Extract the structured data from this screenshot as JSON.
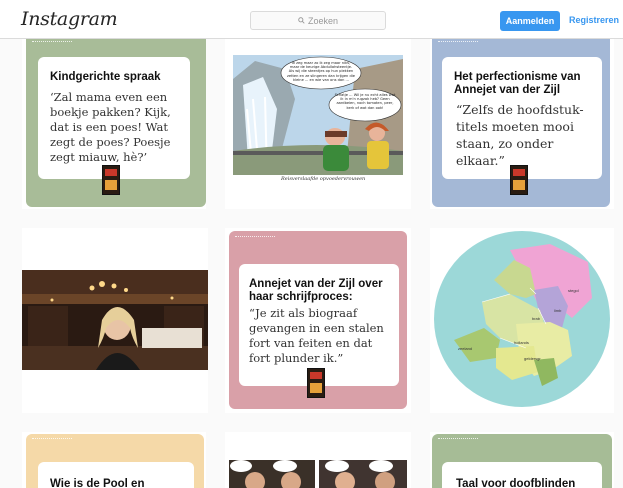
{
  "header": {
    "logo": "Instagram",
    "search_placeholder": "Zoeken",
    "login_label": "Aanmelden",
    "register_label": "Registreren"
  },
  "colors": {
    "accent": "#3897f0",
    "green_frame": "#a8bc98",
    "blue_frame": "#a4b8d6",
    "pink_frame": "#d9a0a8",
    "orange_frame": "#f5d9a8",
    "sage_frame": "#a6bc96"
  },
  "posts": {
    "p1": {
      "title": "Kindgerichte spraak",
      "quote": "‘Zal mama even een boekje pakken? Kijk, dat is een poes! Wat zegt de poes? Poesje zegt miauw, hè?’"
    },
    "p2": {
      "caption": "Reisverslaafde opvoedervrouwen",
      "speech_left": "Ik zeg maar zo ik zeg maar niks, maar de keurige Abdullahsteentje. Als wij die steentjes op hun plekken zetten en ze slingeren dan krijgen die kleine ... en wie van ons dan ...",
      "speech_right": "Schatje ... Wil je nu echt alles wat ik in m'n rugzak heb? Geen aardbeien, noch tomaten, peer, kerk of wat dan ook!"
    },
    "p3": {
      "title": "Het perfectionisme van Annejet van der Zijl",
      "quote": "“Zelfs de hoofdstuk-titels moeten mooi staan, zo onder elkaar.”"
    },
    "p5": {
      "title": "Annejet van der Zijl over haar schrijfproces:",
      "quote": "“Je zit als biograaf gevangen in een stalen fort van feiten en dat fort plunder ik.”"
    },
    "p6": {
      "labels": [
        "stegol",
        "brab",
        "limb",
        "zeeland",
        "hollands",
        "geldersgr"
      ]
    },
    "p7": {
      "title": "Wie is de Pool en"
    },
    "p9": {
      "title": "Taal voor doofblinden"
    }
  }
}
